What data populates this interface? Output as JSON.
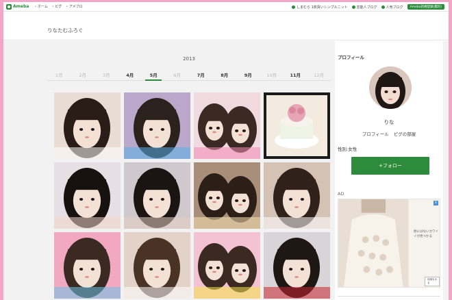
{
  "topbar": {
    "logo": "Ameba",
    "nav": [
      "ホーム",
      "ピグ",
      "アメブロ"
    ],
    "links": [
      "しまむら 1枚買いシンプルニット",
      "芸能人ブログ",
      "人気ブログ"
    ],
    "register": "Ameba新規登録(無料)"
  },
  "blog": {
    "title": "りなたむふろぐ"
  },
  "archive": {
    "year": "2013",
    "months": [
      {
        "label": "1月",
        "has": false
      },
      {
        "label": "2月",
        "has": false
      },
      {
        "label": "3月",
        "has": false
      },
      {
        "label": "4月",
        "has": true
      },
      {
        "label": "5月",
        "has": true,
        "active": true
      },
      {
        "label": "6月",
        "has": false
      },
      {
        "label": "7月",
        "has": true
      },
      {
        "label": "8月",
        "has": true
      },
      {
        "label": "9月",
        "has": true
      },
      {
        "label": "10月",
        "has": false
      },
      {
        "label": "11月",
        "has": true
      },
      {
        "label": "12月",
        "has": false
      }
    ]
  },
  "sidebar": {
    "heading": "プロフィール",
    "nickname": "りな",
    "links": [
      "プロフィール",
      "ピグの部屋"
    ],
    "gender": "性別:女性",
    "follow": "+フォロー",
    "ad_label": "AD",
    "ad_text": "他にはないカワイイが見つかる",
    "ad_button": "詳細をみる"
  },
  "photos": [
    {
      "bg": "#e9dcd4",
      "hair": "#2a1d18",
      "accent": "#ffffff"
    },
    {
      "bg": "#b9a8c9",
      "hair": "#2b211d",
      "accent": "#5ab0e8"
    },
    {
      "bg": "#f1d9e0",
      "hair": "#3b2a24",
      "accent": "#f08ab0"
    },
    {
      "bg": "#1a1a1a",
      "hair": "#e0b7c0",
      "accent": "#f3eadf"
    },
    {
      "bg": "#e6e0e4",
      "hair": "#17110f",
      "accent": "#f2d6c9"
    },
    {
      "bg": "#cfc8cc",
      "hair": "#1a1412",
      "accent": "#e8cfc2"
    },
    {
      "bg": "#a98f7a",
      "hair": "#2c1f17",
      "accent": "#f7e2b0"
    },
    {
      "bg": "#d4c2b5",
      "hair": "#30211a",
      "accent": "#ffffff"
    },
    {
      "bg": "#f2a8c0",
      "hair": "#3a2a22",
      "accent": "#6bc2e8"
    },
    {
      "bg": "#e3d2c7",
      "hair": "#4a3226",
      "accent": "#ffffff"
    },
    {
      "bg": "#f3c3d3",
      "hair": "#3a2a22",
      "accent": "#f5e14a"
    },
    {
      "bg": "#d9d4d8",
      "hair": "#1f1714",
      "accent": "#c8242f"
    }
  ]
}
